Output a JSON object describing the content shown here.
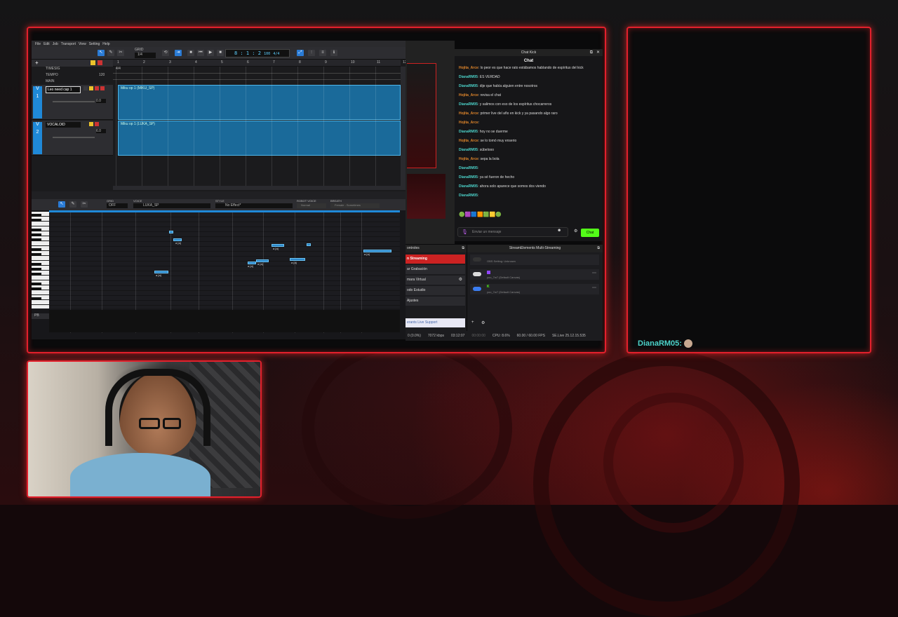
{
  "daw": {
    "menu": [
      "File",
      "Edit",
      "Job",
      "Transport",
      "View",
      "Setting",
      "Help"
    ],
    "grid_label": "GRID",
    "grid_value": "1/4",
    "position": "8 : 1 : 2",
    "tempo_small": "100",
    "sig_small": "4/4",
    "ruler_marks": [
      "1",
      "2",
      "3",
      "4",
      "5",
      "6",
      "7",
      "8",
      "9",
      "10",
      "11",
      "12"
    ],
    "rows": {
      "timesig": "TIMESIG",
      "tempo": "TEMPO",
      "main": "MAIN",
      "timesig_val": "4/4",
      "tempo_val": "120"
    },
    "tracks": [
      {
        "num": "1",
        "name": "Leo need cap 1",
        "clip": "Miku op 1 (MIKU_SP)",
        "vol": "0.0"
      },
      {
        "num": "2",
        "name": "VOCALOID",
        "clip": "Miku op 1 (LUKA_SP)",
        "vol": "6.0"
      }
    ],
    "editor": {
      "grid_label": "GRID",
      "grid_val": "OFF",
      "voice_label": "VOICE",
      "voice_val": "LUKA_SP",
      "style_label": "STYLE",
      "style_val": "No Effect*",
      "robot_label": "ROBOT VOICE",
      "robot_val": "Normal",
      "breath_label": "BREATH",
      "breath_val": "Female - Sometimes",
      "pb_label": "PB",
      "note_lyric": "a [a]"
    }
  },
  "chat": {
    "title": "Chat Kick",
    "header": "Chat",
    "messages": [
      {
        "user": "Hojita_Arce",
        "c": "u1",
        "text": "lo peor es que hace rato estábamos hablando de espíritus del kick"
      },
      {
        "user": "DianaRM05",
        "c": "u2",
        "text": "ES VERDAD"
      },
      {
        "user": "DianaRM05",
        "c": "u2",
        "text": "dije que había alguien entre nosotros"
      },
      {
        "user": "Hojita_Arce",
        "c": "u1",
        "text": "revisa el chat"
      },
      {
        "user": "DianaRM05",
        "c": "u2",
        "text": "y salimos con eso de los espíritus chocarreros"
      },
      {
        "user": "Hojita_Arce",
        "c": "u1",
        "text": "primer live del año en kick y ya pasando algo raro"
      },
      {
        "user": "Hojita_Arce",
        "c": "u1",
        "text": ""
      },
      {
        "user": "DianaRM05",
        "c": "u2",
        "text": "hoy no se duerme"
      },
      {
        "user": "Hojita_Arce",
        "c": "u1",
        "text": "se lo tomó muy enserio"
      },
      {
        "user": "DianaRM05",
        "c": "u2",
        "text": "súbelooo"
      },
      {
        "user": "Hojita_Arce",
        "c": "u1",
        "text": "sepa la bola"
      },
      {
        "user": "DianaRM05",
        "c": "u2",
        "text": ""
      },
      {
        "user": "DianaRM05",
        "c": "u2",
        "text": "ya sé fueron de hecho"
      },
      {
        "user": "DianaRM05",
        "c": "u2",
        "text": "ahora solo aparece que somos dos viendo"
      },
      {
        "user": "DianaRM05",
        "c": "u2",
        "text": ""
      }
    ],
    "input_placeholder": "Enviar un mensaje",
    "send": "Chat"
  },
  "obs": {
    "controls_title": "ontroles",
    "controls": [
      "n Streaming",
      "ar Grabación",
      "mara Virtual",
      "odo Estudio",
      "Ajustes"
    ],
    "support": "erants Live Support",
    "multi_title": "StreamElements Multi-Streaming",
    "outputs": [
      {
        "name": "OBS Setting: Unknown"
      },
      {
        "name": "yoo_7w7 (Default Canvas)"
      },
      {
        "name": "yoo_7w7 (Default Canvas)"
      }
    ],
    "status": [
      "0 (0.0%)",
      "7072 kbps",
      "03:12:07",
      "00:00:00",
      "CPU: 8.6%",
      "60.00 / 60.00 FPS",
      "SE.Live 25.12.15.535"
    ]
  },
  "right_chat": {
    "user": "DianaRM05:"
  }
}
